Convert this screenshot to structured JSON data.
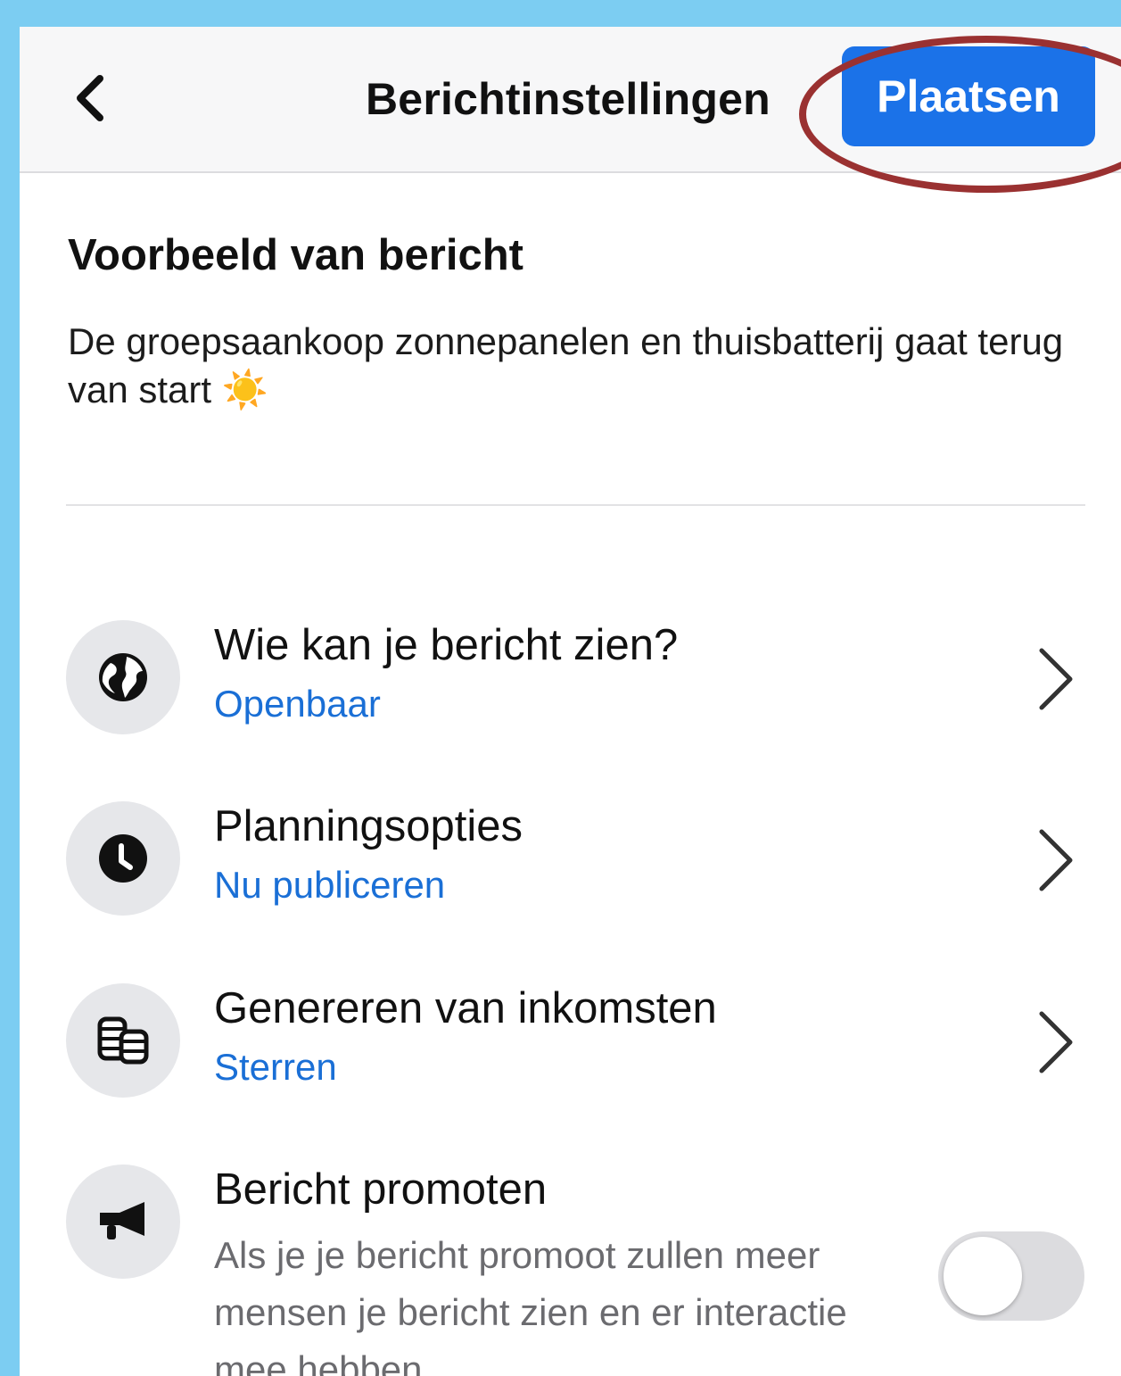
{
  "header": {
    "title": "Berichtinstellingen",
    "post_label": "Plaatsen"
  },
  "preview": {
    "heading": "Voorbeeld van bericht",
    "text": "De groepsaankoop zonnepanelen en thuisbatterij gaat terug van start ☀️"
  },
  "settings": [
    {
      "title": "Wie kan je bericht zien?",
      "value": "Openbaar",
      "icon": "globe-icon"
    },
    {
      "title": "Planningsopties",
      "value": "Nu publiceren",
      "icon": "clock-icon"
    },
    {
      "title": "Genereren van inkomsten",
      "value": "Sterren",
      "icon": "coins-icon"
    }
  ],
  "promote": {
    "title": "Bericht promoten",
    "description": "Als je je bericht promoot zullen meer mensen je bericht zien en er interactie mee hebben.",
    "enabled": false,
    "icon": "megaphone-icon"
  },
  "colors": {
    "accent": "#1b72e8",
    "link": "#1a6fd6",
    "annotation": "#9a3131",
    "background": "#7ccdf2"
  }
}
